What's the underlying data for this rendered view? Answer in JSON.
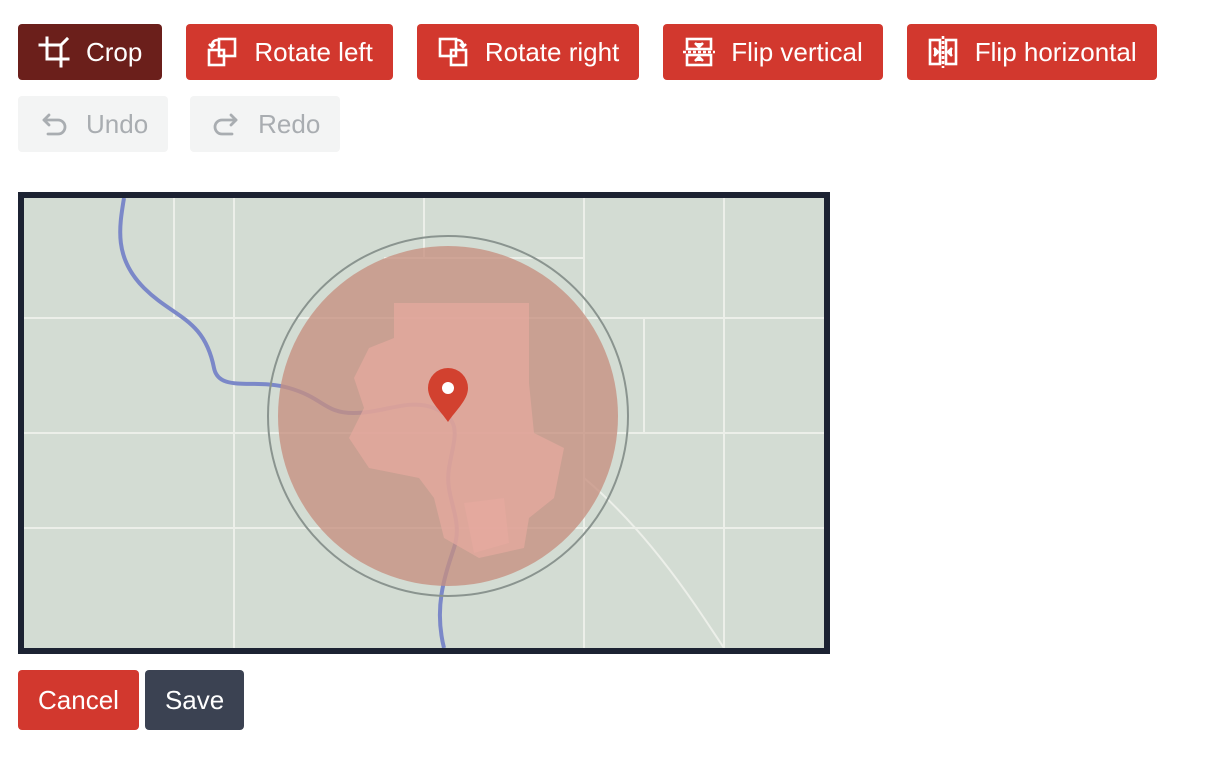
{
  "toolbar": {
    "crop": {
      "label": "Crop",
      "icon": "crop-icon",
      "active": true
    },
    "rotate_left": {
      "label": "Rotate left",
      "icon": "rotate-left-icon"
    },
    "rotate_right": {
      "label": "Rotate right",
      "icon": "rotate-right-icon"
    },
    "flip_vertical": {
      "label": "Flip vertical",
      "icon": "flip-vertical-icon"
    },
    "flip_horizontal": {
      "label": "Flip horizontal",
      "icon": "flip-horizontal-icon"
    },
    "undo": {
      "label": "Undo",
      "icon": "undo-icon",
      "disabled": true
    },
    "redo": {
      "label": "Redo",
      "icon": "redo-icon",
      "disabled": true
    }
  },
  "image": {
    "icon": "map-pin-icon"
  },
  "actions": {
    "cancel_label": "Cancel",
    "save_label": "Save"
  },
  "colors": {
    "primary": "#d2382e",
    "active": "#6b1f1b",
    "disabled_bg": "#f3f4f4",
    "disabled_text": "#a9adb1",
    "save": "#3b4252",
    "frame": "#1c2232"
  }
}
